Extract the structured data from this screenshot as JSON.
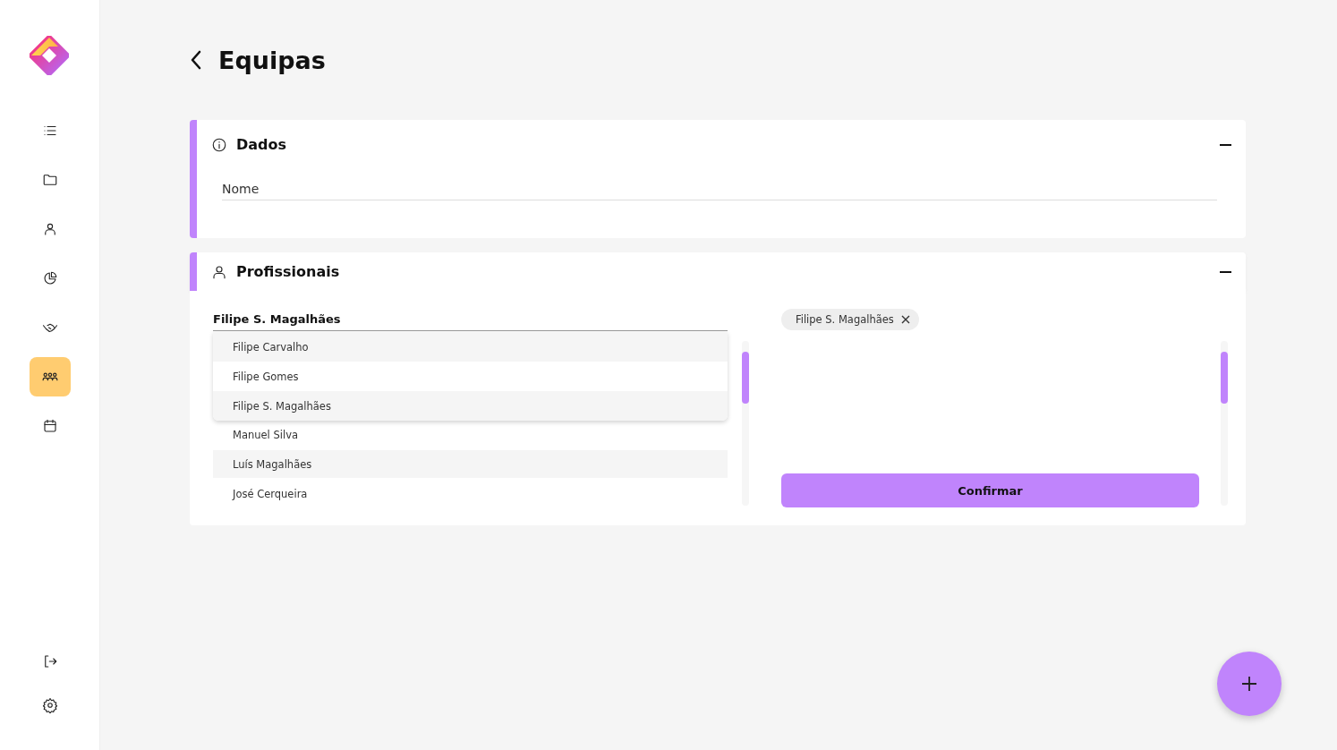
{
  "sidebar": {
    "items": [
      {
        "kind": "list",
        "selected": false
      },
      {
        "kind": "folder",
        "selected": false
      },
      {
        "kind": "person",
        "selected": false
      },
      {
        "kind": "pie",
        "selected": false
      },
      {
        "kind": "handshake",
        "selected": false
      },
      {
        "kind": "team",
        "selected": true
      },
      {
        "kind": "calendar",
        "selected": false
      }
    ],
    "bottom_items": [
      {
        "kind": "logout"
      },
      {
        "kind": "settings"
      }
    ]
  },
  "header": {
    "title": "Equipas"
  },
  "sections": [
    {
      "kind": "info",
      "title": "Dados",
      "expanded": true,
      "field": {
        "placeholder": "Nome"
      }
    },
    {
      "kind": "people",
      "title": "Profissionais",
      "expanded": true,
      "search": {
        "value": "Filipe S. Magalhães"
      },
      "dropdown": [
        "Filipe Carvalho",
        "Filipe Gomes",
        "Filipe S. Magalhães"
      ],
      "list": [
        "Manuel Silva",
        "Luís Magalhães",
        "José Cerqueira"
      ],
      "chips": [
        "Filipe S. Magalhães"
      ],
      "button": "Confirmar"
    }
  ]
}
